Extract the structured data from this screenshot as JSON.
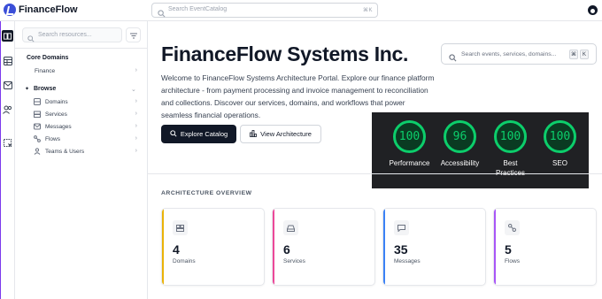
{
  "app": {
    "name": "FinanceFlow"
  },
  "topbar": {
    "search_placeholder": "Search EventCatalog",
    "shortcut": "⌘K"
  },
  "sidebar": {
    "search_placeholder": "Search resources...",
    "core_domains": {
      "heading": "Core Domains",
      "items": [
        {
          "label": "Finance"
        }
      ]
    },
    "browse": {
      "heading": "Browse",
      "items": [
        {
          "label": "Domains"
        },
        {
          "label": "Services"
        },
        {
          "label": "Messages"
        },
        {
          "label": "Flows"
        },
        {
          "label": "Teams & Users"
        }
      ]
    }
  },
  "hero": {
    "title": "FinanceFlow Systems Inc.",
    "description": "Welcome to FinanceFlow Systems Architecture Portal. Explore our finance platform architecture - from payment processing and invoice management to reconciliation and collections. Discover our services, domains, and workflows that power seamless financial operations.",
    "primary_button": "Explore Catalog",
    "secondary_button": "View Architecture"
  },
  "main_search": {
    "placeholder": "Search events, services, domains...",
    "key1": "⌘",
    "key2": "K"
  },
  "lighthouse": {
    "scores": [
      {
        "label": "Performance",
        "score": "100"
      },
      {
        "label": "Accessibility",
        "score": "96"
      },
      {
        "label": "Best Practices",
        "score": "100"
      },
      {
        "label": "SEO",
        "score": "100"
      }
    ],
    "color": "#0cce6b"
  },
  "overview": {
    "title": "ARCHITECTURE OVERVIEW",
    "cards": [
      {
        "value": "4",
        "label": "Domains",
        "color": "#eab308"
      },
      {
        "value": "6",
        "label": "Services",
        "color": "#ec4899"
      },
      {
        "value": "35",
        "label": "Messages",
        "color": "#3b82f6"
      },
      {
        "value": "5",
        "label": "Flows",
        "color": "#a855f7"
      }
    ]
  }
}
